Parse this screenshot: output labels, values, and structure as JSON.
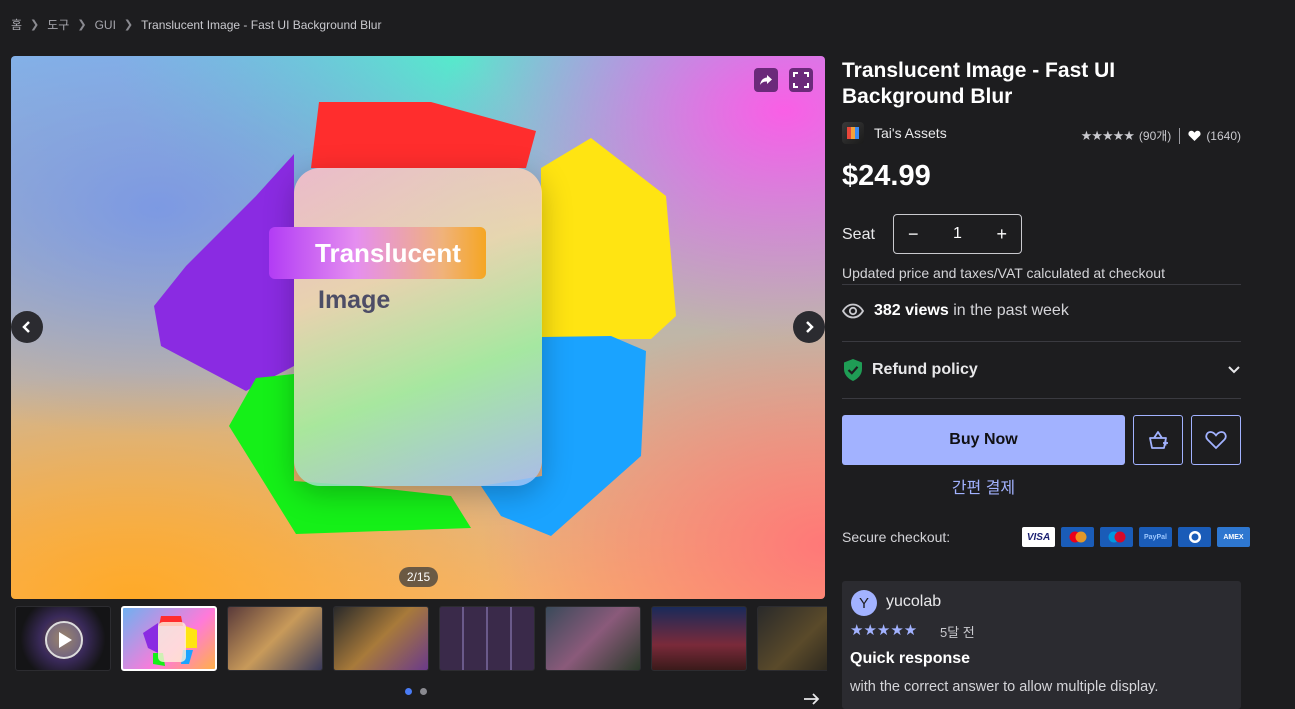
{
  "breadcrumb": {
    "home": "홈",
    "level1": "도구",
    "level2": "GUI",
    "current": "Translucent Image - Fast UI Background Blur"
  },
  "gallery": {
    "hero_label_1": "Translucent",
    "hero_label_2": "Image",
    "counter": "2/15",
    "share_icon": "share-icon",
    "fullscreen_icon": "fullscreen-icon",
    "thumbnail_count": 8,
    "active_thumbnail": 2,
    "dots": 2
  },
  "product": {
    "title": "Translucent Image - Fast UI Background Blur",
    "publisher": "Tai's Assets",
    "rating_stars": "★★★★★",
    "rating_count": "(90개)",
    "favorites": "(1640)",
    "price": "$24.99",
    "seat_label": "Seat",
    "seat_minus": "−",
    "seat_value": "1",
    "seat_plus": "+",
    "tax_note": "Updated price and taxes/VAT calculated at checkout",
    "views_count": "382 views",
    "views_suffix": "in the past week",
    "refund_policy": "Refund policy",
    "buy_now": "Buy Now",
    "quick_pay": "간편 결제",
    "secure_checkout": "Secure checkout:",
    "payment_methods": [
      "VISA",
      "mastercard",
      "maestro",
      "PayPal",
      "Diners",
      "AMEX"
    ]
  },
  "review": {
    "avatar_letter": "Y",
    "user": "yucolab",
    "stars": "★★★★★",
    "date": "5달 전",
    "title": "Quick response",
    "body": "with the correct answer to allow multiple display."
  },
  "colors": {
    "accent": "#a2b2ff",
    "background": "#1d1d1f",
    "panel": "#2b2b30"
  }
}
